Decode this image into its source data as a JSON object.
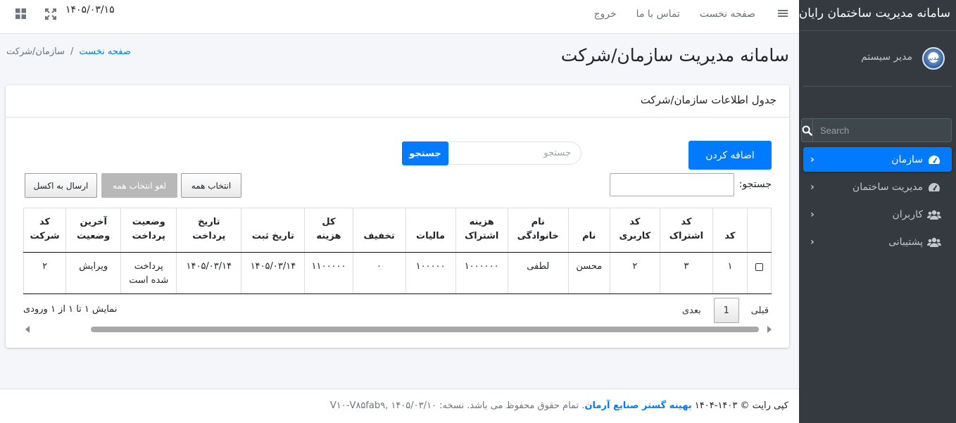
{
  "sidebar": {
    "brand": "سامانه مدیریت ساختمان رایان",
    "user_name": "مدیر سیستم",
    "avatar_text": "مدیر",
    "search_placeholder": "Search",
    "items": [
      {
        "label": "سازمان",
        "icon": "tachometer-icon",
        "active": true
      },
      {
        "label": "مدیریت ساختمان",
        "icon": "tachometer-icon",
        "active": false
      },
      {
        "label": "کاربران",
        "icon": "users-icon",
        "active": false
      },
      {
        "label": "پشتیبانی",
        "icon": "users-icon",
        "active": false
      }
    ]
  },
  "topbar": {
    "links": [
      "صفحه نخست",
      "تماس با ما",
      "خروج"
    ],
    "date": "۱۴۰۵/۰۳/۱۵"
  },
  "header": {
    "title": "سامانه مدیریت سازمان/شرکت",
    "breadcrumb_home": "صفحه نخست",
    "breadcrumb_sep": "/",
    "breadcrumb_current": "سازمان/شرکت"
  },
  "card": {
    "title": "جدول اطلاعات سازمان/شرکت",
    "add_button": "اضافه کردن",
    "search_placeholder": "جستجو",
    "search_button": "جستجو",
    "filter_label": "جستجو:",
    "select_all": "انتخاب همه",
    "deselect_all": "لغو انتخاب همه",
    "export_excel": "ارسال به اکسل",
    "columns": [
      [
        "",
        ""
      ],
      [
        "",
        "کد"
      ],
      [
        "کد",
        "اشتراک"
      ],
      [
        "کد",
        "کاربری"
      ],
      [
        "",
        "نام"
      ],
      [
        "نام",
        "خانوادگی"
      ],
      [
        "هزینه",
        "اشتراک"
      ],
      [
        "",
        "مالیات"
      ],
      [
        "",
        "تخفیف"
      ],
      [
        "کل",
        "هزینه"
      ],
      [
        "",
        "تاریخ ثبت"
      ],
      [
        "تاریخ",
        "پرداخت"
      ],
      [
        "وضعیت",
        "پرداخت"
      ],
      [
        "آخرین",
        "وضعیت"
      ],
      [
        "کد",
        "شرکت"
      ]
    ],
    "rows": [
      [
        "",
        "۱",
        "۳",
        "۲",
        "محسن",
        "لطفی",
        "۱۰۰۰۰۰۰",
        "۱۰۰۰۰۰",
        "۰",
        "۱۱۰۰۰۰۰",
        "۱۴۰۵/۰۳/۱۴",
        "۱۴۰۵/۰۳/۱۴",
        "پرداخت\nشده است",
        "ویرایش",
        "۲"
      ]
    ],
    "pager": {
      "prev": "قبلی",
      "page": "1",
      "next": "بعدی"
    },
    "info": "نمایش ۱ تا ۱ از ۱ ورودی"
  },
  "footer": {
    "copyright": "کپی رایت © ۱۴۰۳-۱۴۰۴",
    "company": "بهینه گستر صنایع آرمان",
    "rights": ". تمام حقوق محفوظ می باشد. نسخه: ۱۴۰۵/۰۳/۱۰ ,V۱۰-V۸۵fab۹"
  }
}
